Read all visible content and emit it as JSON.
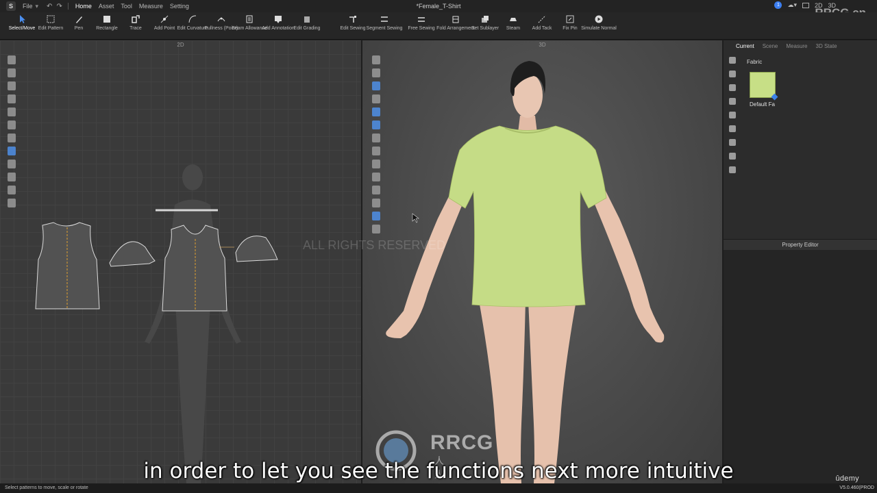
{
  "menu": {
    "app_logo": "S",
    "items": [
      "File",
      "Home",
      "Asset",
      "Tool",
      "Measure",
      "Setting"
    ],
    "active": "Home",
    "document_title": "*Female_T-Shirt",
    "view_modes": [
      "2D",
      "3D"
    ],
    "notification_count": "1"
  },
  "toolbar": {
    "tools": [
      {
        "label": "Select/Move",
        "icon": "arrow-cursor-icon",
        "active": true
      },
      {
        "label": "Edit Pattern",
        "icon": "edit-pattern-icon"
      },
      {
        "label": "Pen",
        "icon": "pen-icon"
      },
      {
        "label": "Rectangle",
        "icon": "rectangle-icon"
      },
      {
        "label": "Trace",
        "icon": "trace-icon"
      },
      {
        "label": "Add Point",
        "icon": "add-point-icon"
      },
      {
        "label": "Edit Curvature",
        "icon": "curvature-icon"
      },
      {
        "label": "Fullness (Point)",
        "icon": "fullness-icon"
      },
      {
        "label": "Seam Allowance",
        "icon": "seam-allowance-icon"
      },
      {
        "label": "Add Annotation",
        "icon": "annotation-icon"
      },
      {
        "label": "Edit Grading",
        "icon": "grading-icon"
      },
      {
        "label": "Edit Sewing",
        "icon": "edit-sewing-icon"
      },
      {
        "label": "Segment Sewing",
        "icon": "segment-sewing-icon"
      },
      {
        "label": "Free Sewing",
        "icon": "free-sewing-icon"
      },
      {
        "label": "Fold Arrangement",
        "icon": "fold-icon"
      },
      {
        "label": "Set Sublayer",
        "icon": "sublayer-icon"
      },
      {
        "label": "Steam",
        "icon": "steam-icon"
      },
      {
        "label": "Add Tack",
        "icon": "tack-icon"
      },
      {
        "label": "Fix Pin",
        "icon": "pin-icon"
      },
      {
        "label": "Simulate Normal",
        "icon": "simulate-icon"
      }
    ]
  },
  "panel_2d": {
    "title": "2D"
  },
  "panel_3d": {
    "title": "3D"
  },
  "right_panel": {
    "tabs": [
      "Current",
      "Scene",
      "Measure",
      "3D State"
    ],
    "active_tab": "Current",
    "section": "Fabric",
    "fabric_name": "Default Fa",
    "fabric_color": "#c7df86",
    "property_editor_title": "Property Editor"
  },
  "status": {
    "hint": "Select patterns to move, scale or rotate",
    "version": "V5.0.460(PROD"
  },
  "overlay": {
    "subtitle": "in order to let you see the functions next more intuitive",
    "rights_watermark": "ALL RIGHTS RESERVED",
    "corner_watermark": "RRCG.cn",
    "center_brand": "RRCG",
    "center_brand_sub": "人人素材",
    "udemy": "ûdemy"
  },
  "colors": {
    "accent_blue": "#3b7ef0",
    "garment_green": "#c7df86",
    "pattern_gray": "#525252"
  }
}
